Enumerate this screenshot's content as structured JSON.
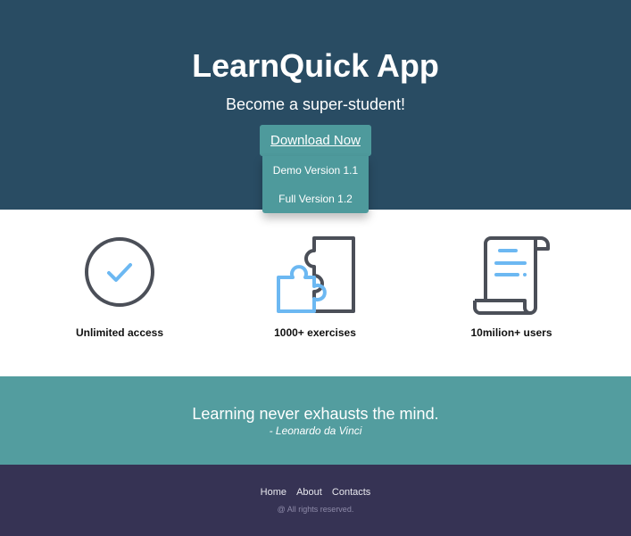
{
  "hero": {
    "title": "LearnQuick App",
    "subtitle": "Become a super-student!",
    "download_label": "Download Now",
    "dropdown": [
      {
        "label": "Demo Version 1.1"
      },
      {
        "label": "Full Version 1.2"
      }
    ],
    "background_color": "#294c63",
    "accent_color": "#4e9a9c"
  },
  "features": [
    {
      "icon": "checkmark-circle-icon",
      "label": "Unlimited access"
    },
    {
      "icon": "puzzle-icon",
      "label": "1000+ exercises"
    },
    {
      "icon": "scroll-document-icon",
      "label": "10milion+ users"
    }
  ],
  "quote": {
    "text": "Learning never exhausts the mind.",
    "author": "- Leonardo da Vinci",
    "background_color": "#539d9f"
  },
  "footer": {
    "links": [
      {
        "label": "Home"
      },
      {
        "label": "About"
      },
      {
        "label": "Contacts"
      }
    ],
    "copyright": "@ All rights reserved.",
    "background_color": "#363354"
  }
}
